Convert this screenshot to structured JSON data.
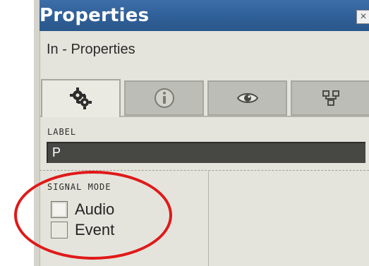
{
  "window": {
    "title": "Properties",
    "close_glyph": "×"
  },
  "subtitle": "In - Properties",
  "tabs": [
    {
      "name": "settings",
      "icon": "gears-icon",
      "active": true
    },
    {
      "name": "info",
      "icon": "info-icon",
      "active": false
    },
    {
      "name": "view",
      "icon": "eye-icon",
      "active": false
    },
    {
      "name": "connections",
      "icon": "connection-icon",
      "active": false
    }
  ],
  "label_section": {
    "caption": "LABEL",
    "value": "P"
  },
  "signal_mode": {
    "caption": "SIGNAL MODE",
    "options": [
      {
        "label": "Audio",
        "selected": true
      },
      {
        "label": "Event",
        "selected": false
      }
    ]
  },
  "colors": {
    "titlebar": "#2f5f97",
    "panel": "#e4e4dc",
    "label_field": "#474743",
    "highlight": "#e01919"
  }
}
